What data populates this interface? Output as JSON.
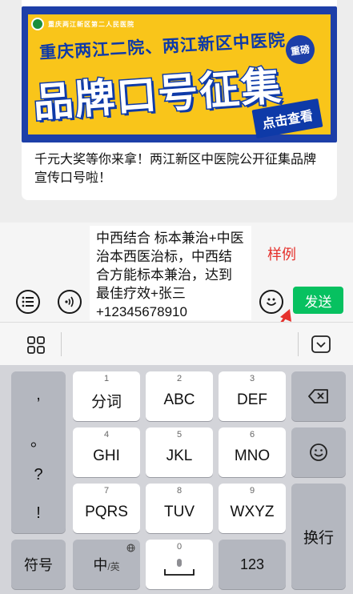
{
  "card": {
    "banner_hospital": "重庆两江新区第二人民医院",
    "banner_line1": "重庆两江二院、两江新区中医院",
    "banner_badge": "重磅",
    "banner_line2": "品牌口号征集",
    "banner_cta": "点击查看",
    "caption": "千元大奖等你来拿！两江新区中医院公开征集品牌宣传口号啦！"
  },
  "input_bar": {
    "message_text": "中西结合 标本兼治+中医治本西医治标，中西结合方能标本兼治，达到最佳疗效+张三+12345678910",
    "annotation_label": "样例",
    "send_label": "发送",
    "annotation_color": "#e5322d",
    "send_color": "#07c160"
  },
  "keyboard": {
    "punctuation": [
      ",",
      "。",
      "?",
      "!"
    ],
    "keys": [
      {
        "num": "1",
        "label": "分词"
      },
      {
        "num": "2",
        "label": "ABC"
      },
      {
        "num": "3",
        "label": "DEF"
      },
      {
        "num": "4",
        "label": "GHI"
      },
      {
        "num": "5",
        "label": "JKL"
      },
      {
        "num": "6",
        "label": "MNO"
      },
      {
        "num": "7",
        "label": "PQRS"
      },
      {
        "num": "8",
        "label": "TUV"
      },
      {
        "num": "9",
        "label": "WXYZ"
      }
    ],
    "symbol_key": "符号",
    "lang_key_main": "中",
    "lang_key_sub": "/英",
    "space_num": "0",
    "num_key": "123",
    "enter_key": "换行"
  },
  "icons": {
    "input_bar_left": "list-icon",
    "input_bar_voice": "voice-icon",
    "emoji": "emoji-icon",
    "toolbar_grid": "grid-icon",
    "toolbar_collapse": "keyboard-collapse-icon",
    "backspace": "backspace-icon",
    "space": "microphone-icon",
    "globe": "globe-icon"
  }
}
